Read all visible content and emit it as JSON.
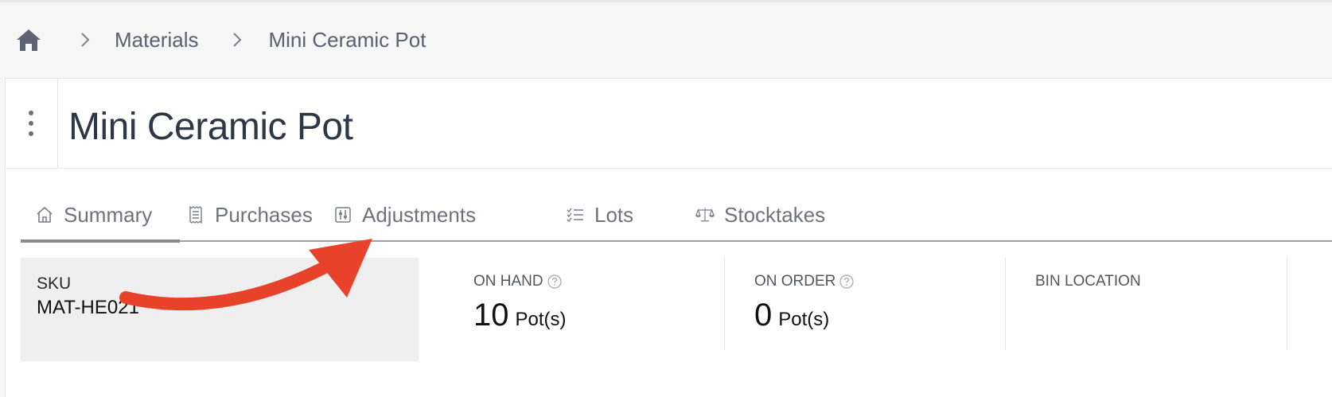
{
  "breadcrumb": {
    "home_icon": "home-icon",
    "items": [
      {
        "label": "Materials"
      },
      {
        "label": "Mini Ceramic Pot"
      }
    ]
  },
  "header": {
    "title": "Mini Ceramic Pot",
    "menu_icon": "kebab-menu-icon"
  },
  "tabs": [
    {
      "label": "Summary",
      "icon": "home-outline-icon",
      "active": true
    },
    {
      "label": "Purchases",
      "icon": "receipt-icon",
      "active": false
    },
    {
      "label": "Adjustments",
      "icon": "adjust-sliders-icon",
      "active": false
    },
    {
      "label": "Lots",
      "icon": "checklist-icon",
      "active": false
    },
    {
      "label": "Stocktakes",
      "icon": "scale-icon",
      "active": false
    }
  ],
  "summary": {
    "sku": {
      "label": "SKU",
      "value": "MAT-HE021"
    },
    "on_hand": {
      "label": "ON HAND",
      "value": "10",
      "unit": "Pot(s)",
      "help_icon": "help-circle-icon"
    },
    "on_order": {
      "label": "ON ORDER",
      "value": "0",
      "unit": "Pot(s)",
      "help_icon": "help-circle-icon"
    },
    "bin_location": {
      "label": "BIN LOCATION"
    }
  },
  "annotation": {
    "arrow_color": "#e8432a"
  },
  "colors": {
    "background": "#f6f6f7",
    "card": "#ffffff",
    "title": "#2f3645",
    "sku_box": "#efefef"
  }
}
